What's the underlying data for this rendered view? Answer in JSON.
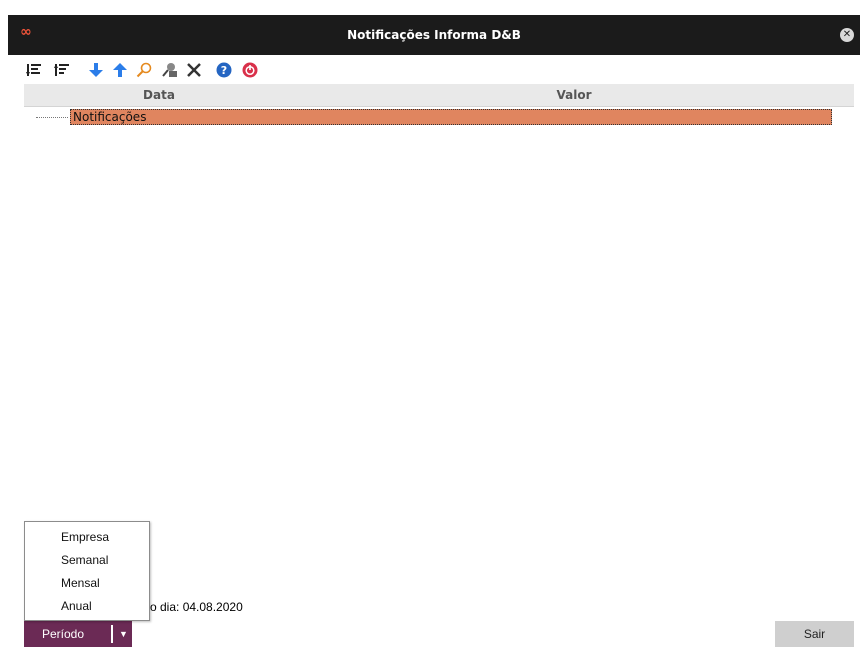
{
  "window": {
    "title": "Notificações Informa D&B",
    "logo_icon": "infinity-logo-icon",
    "close_icon": "close-icon"
  },
  "toolbar": {
    "icons": [
      "expand-all-icon",
      "collapse-all-icon",
      "arrow-down-icon",
      "arrow-up-icon",
      "search-icon",
      "find-user-icon",
      "clear-filter-icon",
      "help-icon",
      "power-icon"
    ]
  },
  "grid": {
    "columns": [
      "Data",
      "Valor"
    ],
    "rows": [
      {
        "label": "Notificações"
      }
    ]
  },
  "footer": {
    "date_text": "o dia: 04.08.2020",
    "periodo_label": "Período",
    "sair_label": "Sair"
  },
  "menu": {
    "items": [
      "Empresa",
      "Semanal",
      "Mensal",
      "Anual"
    ]
  },
  "colors": {
    "titlebar": "#1b1b1b",
    "selected_row": "#e0855f",
    "periodo_button": "#6b2a55",
    "sair_button": "#cfcfcf"
  }
}
